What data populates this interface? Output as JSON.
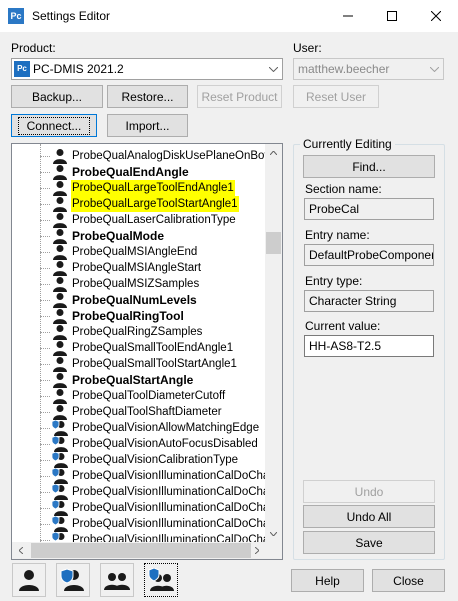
{
  "window": {
    "app_icon_text": "Pc",
    "title": "Settings Editor",
    "minimize": "—",
    "maximize": "☐",
    "close": "✕"
  },
  "product": {
    "label": "Product:",
    "badge": "Pc",
    "value": "PC-DMIS 2021.2"
  },
  "user": {
    "label": "User:",
    "value": "matthew.beecher"
  },
  "buttons": {
    "backup": "Backup...",
    "restore": "Restore...",
    "reset_product": "Reset Product",
    "reset_user": "Reset User",
    "connect": "Connect...",
    "import": "Import..."
  },
  "tree": {
    "rows": [
      {
        "text": "ProbeQualAnalogDiskUsePlaneOnBottom",
        "bold": false,
        "highlight": false,
        "icon": "user-icon"
      },
      {
        "text": "ProbeQualEndAngle",
        "bold": true,
        "highlight": false,
        "icon": "user-icon"
      },
      {
        "text": "ProbeQualLargeToolEndAngle1",
        "bold": false,
        "highlight": true,
        "icon": "user-icon"
      },
      {
        "text": "ProbeQualLargeToolStartAngle1",
        "bold": false,
        "highlight": true,
        "icon": "user-icon"
      },
      {
        "text": "ProbeQualLaserCalibrationType",
        "bold": false,
        "highlight": false,
        "icon": "user-icon"
      },
      {
        "text": "ProbeQualMode",
        "bold": true,
        "highlight": false,
        "icon": "user-icon"
      },
      {
        "text": "ProbeQualMSIAngleEnd",
        "bold": false,
        "highlight": false,
        "icon": "user-icon"
      },
      {
        "text": "ProbeQualMSIAngleStart",
        "bold": false,
        "highlight": false,
        "icon": "user-icon"
      },
      {
        "text": "ProbeQualMSIZSamples",
        "bold": false,
        "highlight": false,
        "icon": "user-icon"
      },
      {
        "text": "ProbeQualNumLevels",
        "bold": true,
        "highlight": false,
        "icon": "user-icon"
      },
      {
        "text": "ProbeQualRingTool",
        "bold": true,
        "highlight": false,
        "icon": "user-icon"
      },
      {
        "text": "ProbeQualRingZSamples",
        "bold": false,
        "highlight": false,
        "icon": "user-icon"
      },
      {
        "text": "ProbeQualSmallToolEndAngle1",
        "bold": false,
        "highlight": false,
        "icon": "user-icon"
      },
      {
        "text": "ProbeQualSmallToolStartAngle1",
        "bold": false,
        "highlight": false,
        "icon": "user-icon"
      },
      {
        "text": "ProbeQualStartAngle",
        "bold": true,
        "highlight": false,
        "icon": "user-icon"
      },
      {
        "text": "ProbeQualToolDiameterCutoff",
        "bold": false,
        "highlight": false,
        "icon": "user-icon"
      },
      {
        "text": "ProbeQualToolShaftDiameter",
        "bold": false,
        "highlight": false,
        "icon": "user-icon"
      },
      {
        "text": "ProbeQualVisionAllowMatchingEdge",
        "bold": false,
        "highlight": false,
        "icon": "user-shield-icon"
      },
      {
        "text": "ProbeQualVisionAutoFocusDisabled",
        "bold": false,
        "highlight": false,
        "icon": "user-shield-icon"
      },
      {
        "text": "ProbeQualVisionCalibrationType",
        "bold": false,
        "highlight": false,
        "icon": "user-shield-icon"
      },
      {
        "text": "ProbeQualVisionIlluminationCalDoCharact",
        "bold": false,
        "highlight": false,
        "icon": "user-shield-icon"
      },
      {
        "text": "ProbeQualVisionIlluminationCalDoCharact",
        "bold": false,
        "highlight": false,
        "icon": "user-shield-icon"
      },
      {
        "text": "ProbeQualVisionIlluminationCalDoCharact",
        "bold": false,
        "highlight": false,
        "icon": "user-shield-icon"
      },
      {
        "text": "ProbeQualVisionIlluminationCalDoCharact",
        "bold": false,
        "highlight": false,
        "icon": "user-shield-icon"
      },
      {
        "text": "ProbeQualVisionIlluminationCalDoCharact",
        "bold": false,
        "highlight": false,
        "icon": "user-shield-icon"
      }
    ]
  },
  "editing": {
    "title": "Currently Editing",
    "find": "Find...",
    "section_label": "Section name:",
    "section_value": "ProbeCal",
    "entry_label": "Entry name:",
    "entry_value": "DefaultProbeComponents",
    "type_label": "Entry type:",
    "type_value": "Character String",
    "current_label": "Current value:",
    "current_value": "HH-AS8-T2.5",
    "undo": "Undo",
    "undo_all": "Undo All",
    "save": "Save"
  },
  "footer": {
    "help": "Help",
    "close": "Close"
  },
  "colors": {
    "highlight": "#ffff00",
    "accent": "#0078d7",
    "shield": "#1e6fc0"
  }
}
